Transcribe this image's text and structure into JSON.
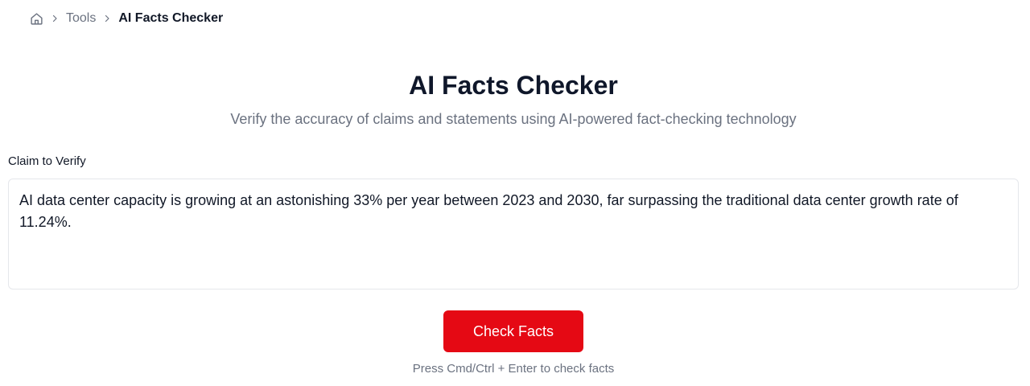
{
  "breadcrumb": {
    "home_icon": "home-icon",
    "separator_icon": "chevron-right-icon",
    "items": [
      {
        "label": "Tools"
      },
      {
        "label": "AI Facts Checker"
      }
    ]
  },
  "header": {
    "title": "AI Facts Checker",
    "subtitle": "Verify the accuracy of claims and statements using AI-powered fact-checking technology"
  },
  "form": {
    "claim_label": "Claim to Verify",
    "claim_value": "AI data center capacity is growing at an astonishing 33% per year between 2023 and 2030, far surpassing the traditional data center growth rate of 11.24%.",
    "submit_label": "Check Facts",
    "hint": "Press Cmd/Ctrl + Enter to check facts"
  },
  "colors": {
    "accent": "#e50914",
    "muted_text": "#6b7280",
    "border": "#e5e7eb"
  }
}
